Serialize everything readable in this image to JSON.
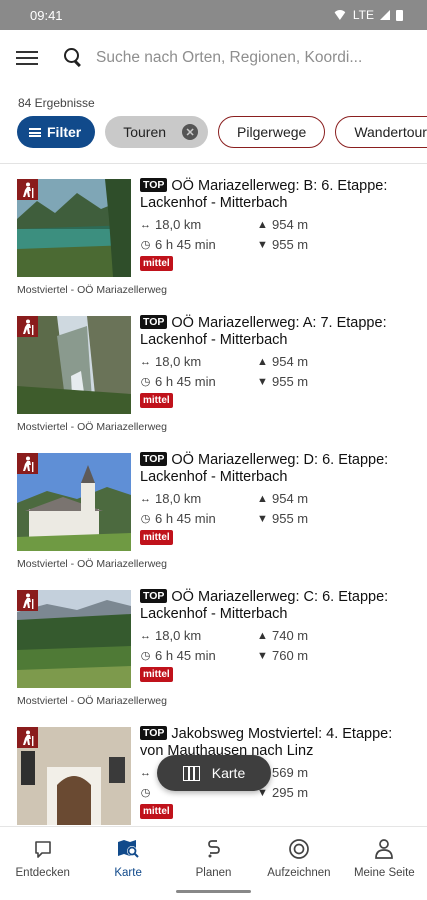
{
  "status_bar": {
    "time": "09:41",
    "network": "LTE"
  },
  "search": {
    "placeholder": "Suche nach Orten, Regionen, Koordi..."
  },
  "results_count": "84 Ergebnisse",
  "chips": {
    "filter": "Filter",
    "touren": "Touren",
    "pilgerwege": "Pilgerwege",
    "wandertouren": "Wandertouren"
  },
  "tours": [
    {
      "top": "TOP",
      "title": "OÖ Mariazellerweg: B: 6. Etappe: Lackenhof - Mitterbach",
      "distance": "18,0 km",
      "duration": "6 h 45 min",
      "ascent": "954 m",
      "descent": "955 m",
      "difficulty": "mittel",
      "region": "Mostviertel - OÖ Mariazellerweg"
    },
    {
      "top": "TOP",
      "title": "OÖ Mariazellerweg: A: 7. Etappe: Lackenhof - Mitterbach",
      "distance": "18,0 km",
      "duration": "6 h 45 min",
      "ascent": "954 m",
      "descent": "955 m",
      "difficulty": "mittel",
      "region": "Mostviertel - OÖ Mariazellerweg"
    },
    {
      "top": "TOP",
      "title": "OÖ Mariazellerweg: D: 6. Etappe: Lackenhof - Mitterbach",
      "distance": "18,0 km",
      "duration": "6 h 45 min",
      "ascent": "954 m",
      "descent": "955 m",
      "difficulty": "mittel",
      "region": "Mostviertel - OÖ Mariazellerweg"
    },
    {
      "top": "TOP",
      "title": "OÖ Mariazellerweg: C: 6. Etappe: Lackenhof - Mitterbach",
      "distance": "18,0 km",
      "duration": "6 h 45 min",
      "ascent": "740 m",
      "descent": "760 m",
      "difficulty": "mittel",
      "region": "Mostviertel - OÖ Mariazellerweg"
    },
    {
      "top": "TOP",
      "title": "Jakobsweg Mostviertel: 4. Etappe: von Mauthausen nach Linz",
      "distance": "",
      "duration": "",
      "ascent": "569 m",
      "descent": "295 m",
      "difficulty": "mittel",
      "region": ""
    }
  ],
  "map_button": "Karte",
  "bottom_nav": [
    {
      "label": "Entdecken",
      "icon": "chat-bubble-icon"
    },
    {
      "label": "Karte",
      "icon": "map-search-icon"
    },
    {
      "label": "Planen",
      "icon": "route-icon"
    },
    {
      "label": "Aufzeichnen",
      "icon": "record-icon"
    },
    {
      "label": "Meine Seite",
      "icon": "person-icon"
    }
  ],
  "colors": {
    "primary": "#114a8b",
    "hike_badge": "#8a1c1c",
    "difficulty_medium": "#c0121b",
    "chip_outline": "#8a1f1f"
  }
}
